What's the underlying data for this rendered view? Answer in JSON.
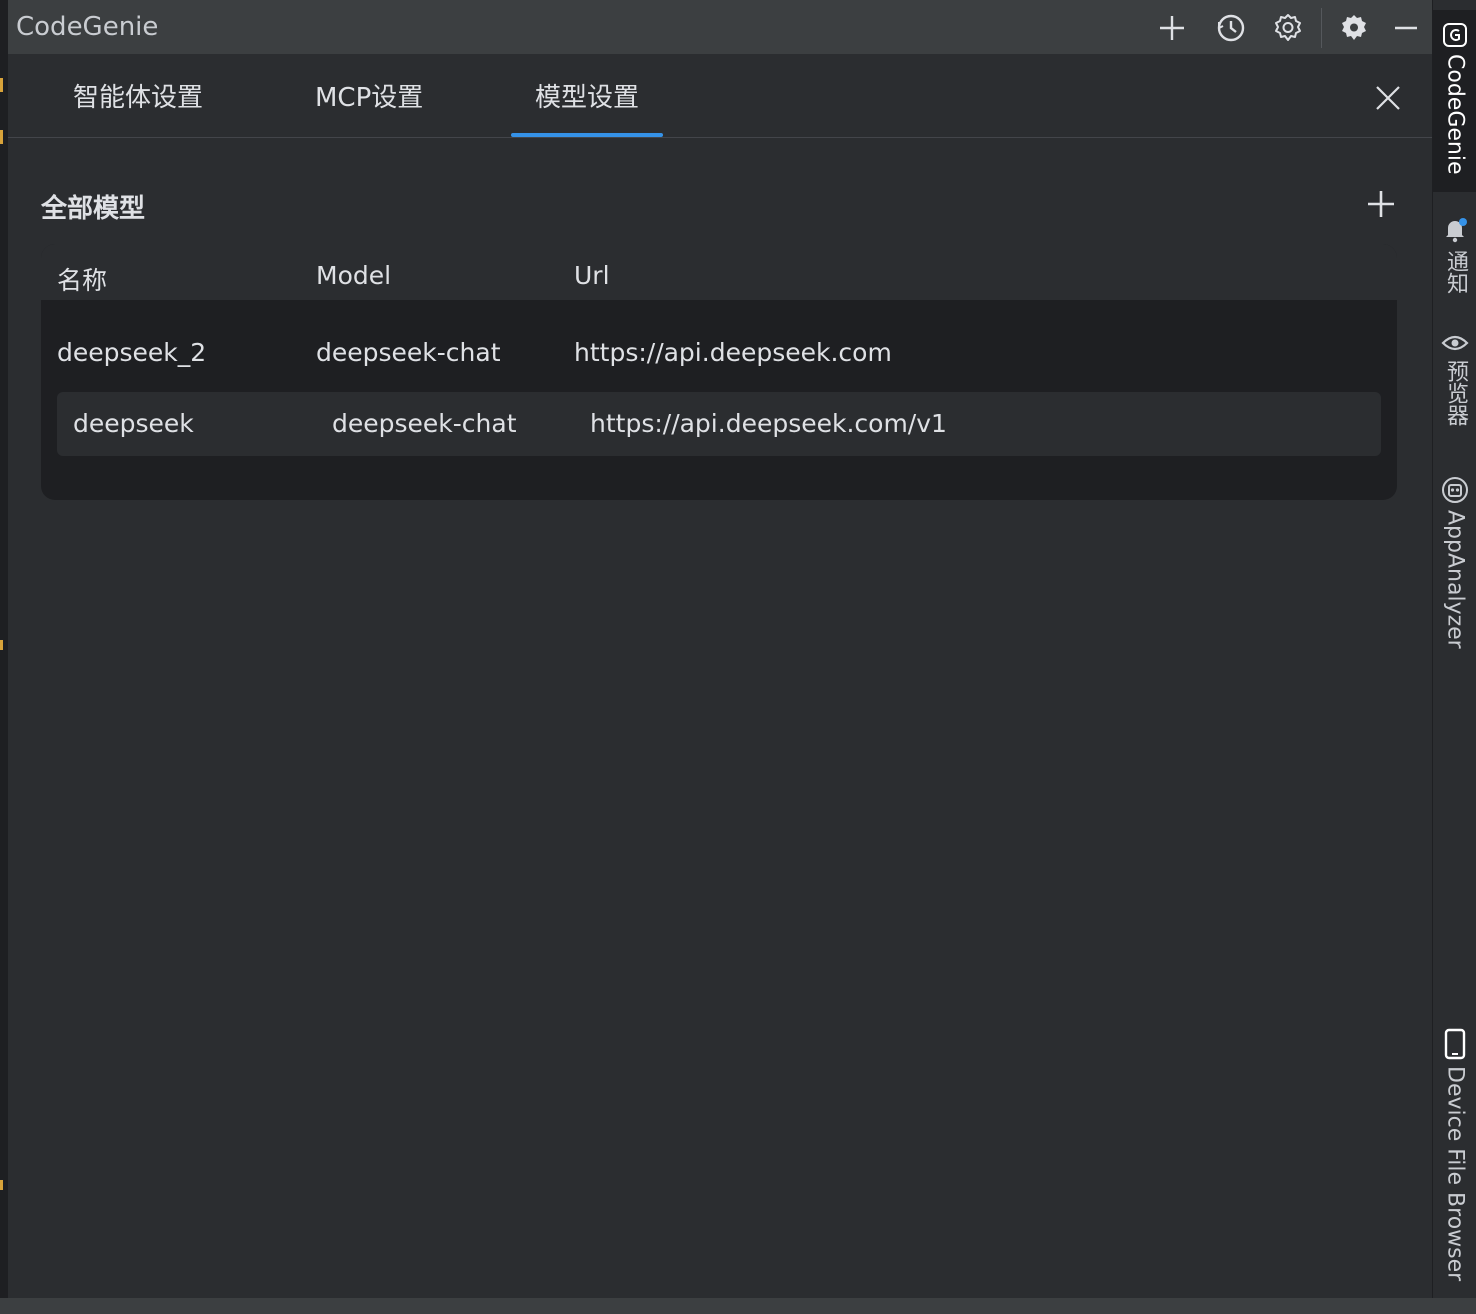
{
  "window": {
    "title": "CodeGenie"
  },
  "toolbar": {
    "icons": [
      "plus-icon",
      "history-icon",
      "settings-outline-icon",
      "gear-icon",
      "minimize-icon"
    ]
  },
  "tabs": [
    {
      "label": "智能体设置",
      "active": false
    },
    {
      "label": "MCP设置",
      "active": false
    },
    {
      "label": "模型设置",
      "active": true
    }
  ],
  "section": {
    "title": "全部模型"
  },
  "table": {
    "columns": [
      "名称",
      "Model",
      "Url"
    ],
    "rows": [
      {
        "name": "deepseek_2",
        "model": "deepseek-chat",
        "url": "https://api.deepseek.com"
      },
      {
        "name": "deepseek",
        "model": "deepseek-chat",
        "url": "https://api.deepseek.com/v1"
      }
    ]
  },
  "right_bar": {
    "items": [
      {
        "label": "CodeGenie",
        "icon": "codegenie-icon",
        "active": true
      },
      {
        "label": "通知",
        "icon": "bell-icon",
        "active": false
      },
      {
        "label": "预览器",
        "icon": "eye-icon",
        "active": false
      },
      {
        "label": "AppAnalyzer",
        "icon": "robot-icon",
        "active": false
      },
      {
        "label": "Device File Browser",
        "icon": "phone-icon",
        "active": false
      }
    ]
  },
  "colors": {
    "accent": "#3592e8",
    "background": "#2b2d30",
    "table_bg": "#1e1f22",
    "notification_dot": "#3592e8"
  }
}
